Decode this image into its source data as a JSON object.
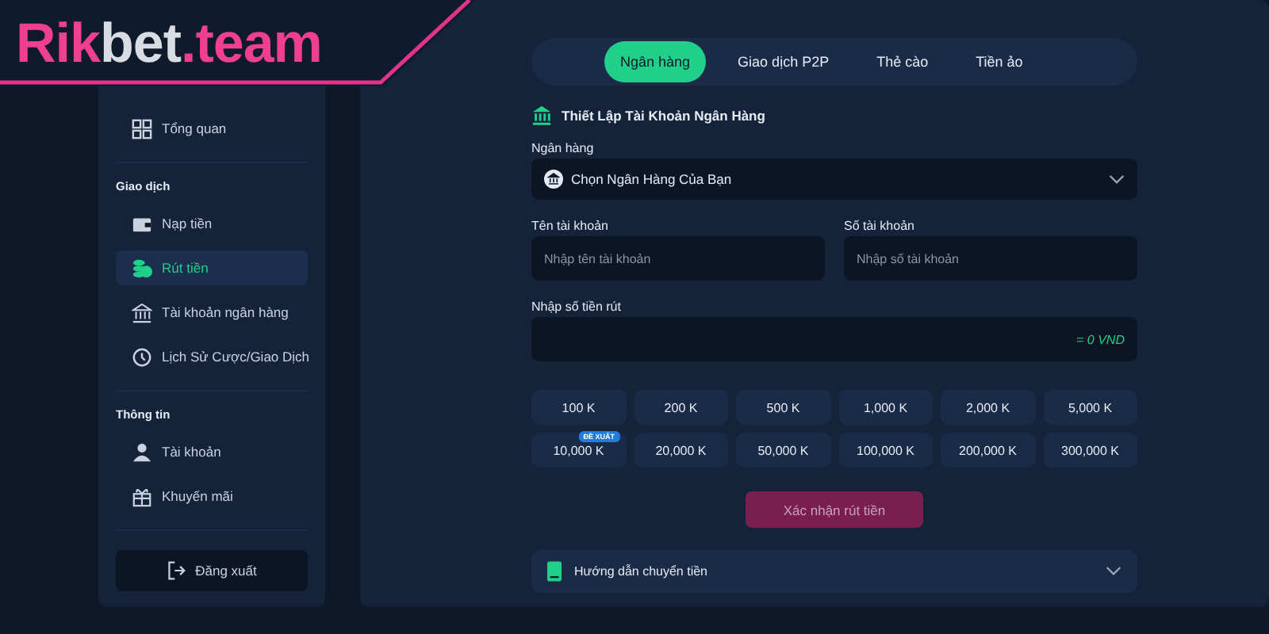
{
  "logo": {
    "parts": [
      {
        "text": "Rik",
        "kind": "accent"
      },
      {
        "text": "bet",
        "kind": "plain"
      },
      {
        "text": ".team",
        "kind": "accent"
      }
    ]
  },
  "sidebar": {
    "sections": [
      {
        "items": [
          {
            "label": "Tổng quan",
            "kind": "grid",
            "selected": false
          }
        ]
      },
      {
        "title": "Giao dịch",
        "items": [
          {
            "label": "Nạp tiền",
            "kind": "wallet",
            "selected": false
          },
          {
            "label": "Rút tiền",
            "kind": "coins",
            "selected": true
          },
          {
            "label": "Tài khoản ngân hàng",
            "kind": "bank",
            "selected": false
          },
          {
            "label": "Lịch Sử Cược/Giao Dịch",
            "kind": "history",
            "selected": false
          }
        ]
      },
      {
        "title": "Thông tin",
        "items": [
          {
            "label": "Tài khoản",
            "kind": "user",
            "selected": false
          },
          {
            "label": "Khuyến mãi",
            "kind": "gift",
            "selected": false
          }
        ]
      }
    ],
    "logout": "Đăng xuất"
  },
  "tabs": [
    {
      "label": "Ngân hàng",
      "selected": true
    },
    {
      "label": "Giao dịch P2P",
      "selected": false
    },
    {
      "label": "Thẻ cào",
      "selected": false
    },
    {
      "label": "Tiền ảo",
      "selected": false
    }
  ],
  "form": {
    "title": "Thiết Lập Tài Khoản Ngân Hàng",
    "bank": {
      "label": "Ngân hàng",
      "value": "Chọn Ngân Hàng Của Bạn"
    },
    "fields": [
      {
        "label": "Tên tài khoản",
        "placeholder": "Nhập tên tài khoản"
      },
      {
        "label": "Số tài khoản",
        "placeholder": "Nhập số tài khoản"
      }
    ],
    "amount": {
      "label": "Nhập số tiền rút",
      "reading": "= 0 VND"
    },
    "chips": [
      {
        "label": "100 K"
      },
      {
        "label": "200 K"
      },
      {
        "label": "500 K"
      },
      {
        "label": "1,000 K"
      },
      {
        "label": "2,000 K"
      },
      {
        "label": "5,000 K"
      },
      {
        "label": "10,000 K",
        "badge": "ĐỀ XUẤT"
      },
      {
        "label": "20,000 K"
      },
      {
        "label": "50,000 K"
      },
      {
        "label": "100,000 K"
      },
      {
        "label": "200,000 K"
      },
      {
        "label": "300,000 K"
      }
    ],
    "submit": {
      "label": "Xác nhận rút tiền",
      "disabled": true
    },
    "guide": {
      "label": "Hướng dẫn chuyển tiền",
      "expanded": false
    }
  }
}
